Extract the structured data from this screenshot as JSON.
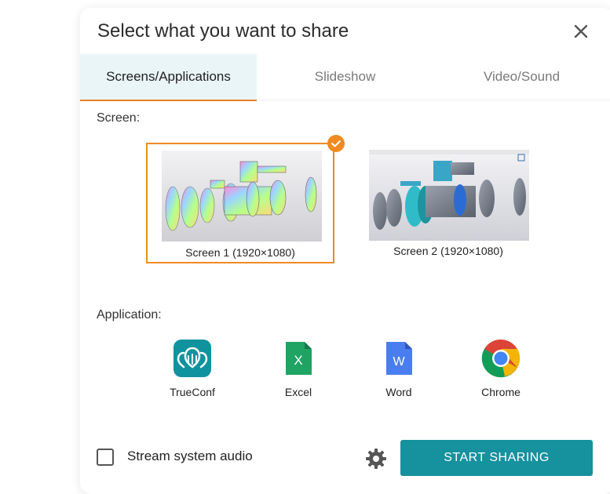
{
  "dialog": {
    "title": "Select what you want to share",
    "close_icon": "close-icon"
  },
  "tabs": [
    {
      "label": "Screens/Applications",
      "active": true
    },
    {
      "label": "Slideshow",
      "active": false
    },
    {
      "label": "Video/Sound",
      "active": false
    }
  ],
  "screen_section": {
    "label": "Screen:",
    "screens": [
      {
        "caption": "Screen 1 (1920×1080)",
        "selected": true
      },
      {
        "caption": "Screen 2 (1920×1080)",
        "selected": false
      }
    ]
  },
  "application_section": {
    "label": "Application:",
    "apps": [
      {
        "label": "TrueConf",
        "icon": "trueconf-icon"
      },
      {
        "label": "Excel",
        "icon": "excel-icon"
      },
      {
        "label": "Word",
        "icon": "word-icon"
      },
      {
        "label": "Chrome",
        "icon": "chrome-icon"
      }
    ]
  },
  "footer": {
    "audio_label": "Stream system audio",
    "audio_checked": false,
    "settings_icon": "gear-icon",
    "start_label": "START SHARING"
  },
  "colors": {
    "accent_orange": "#f08a23",
    "primary_teal": "#16919e",
    "active_tab_bg": "#eaf5f7"
  }
}
